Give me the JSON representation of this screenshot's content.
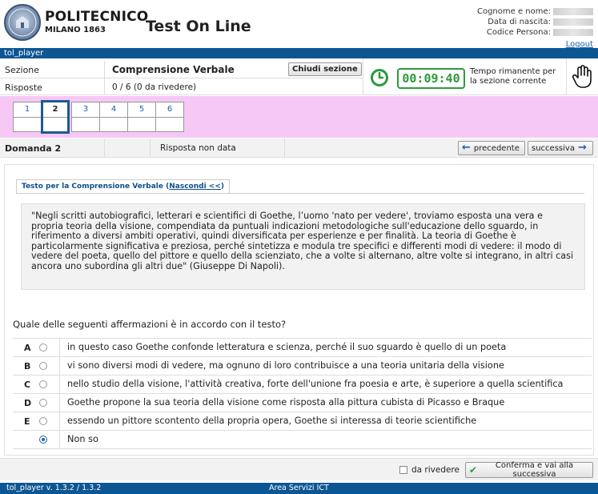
{
  "header": {
    "brand_line1": "POLITECNICO",
    "brand_line2": "MILANO 1863",
    "app_title": "Test On Line",
    "user_labels": [
      "Cognome e nome:",
      "Data di nascita:",
      "Codice Persona:"
    ],
    "logout": "Logout"
  },
  "topbar": {
    "label": "tol_player"
  },
  "info": {
    "sezione_label": "Sezione",
    "sezione_value": "Comprensione Verbale",
    "risposte_label": "Risposte",
    "risposte_value": "0 / 6 (0 da rivedere)",
    "close_section": "Chiudi sezione",
    "timer": "00:09:40",
    "timer_caption": "Tempo rimanente per la sezione corrente"
  },
  "nav": {
    "questions": [
      "1",
      "2",
      "3",
      "4",
      "5",
      "6"
    ],
    "current": "2"
  },
  "domanda": {
    "label": "Domanda 2",
    "status": "Risposta non data",
    "prev": "precedente",
    "next": "successiva"
  },
  "passage": {
    "tab_label": "Testo per la Comprensione Verbale",
    "tab_link": "Nascondi <<",
    "text": "\"Negli scritti autobiografici, letterari e scientifici di Goethe, l’uomo 'nato per vedere', troviamo esposta una vera e propria teoria della visione, compendiata da puntuali indicazioni metodologiche sull'educazione dello sguardo, in riferimento a diversi ambiti operativi, quindi diversificata per esperienze e per finalità. La teoria di Goethe è particolarmente significativa e preziosa, perché sintetizza e modula tre specifici e differenti modi di vedere: il modo di vedere del poeta, quello del pittore e quello della scienziato, che a volte si alternano, altre volte si integrano, in altri casi ancora uno subordina gli altri due\" (Giuseppe Di Napoli)."
  },
  "question": "Quale delle seguenti affermazioni è in accordo con il testo?",
  "answers": [
    {
      "letter": "A",
      "text": "in questo caso Goethe confonde letteratura e scienza, perché il suo sguardo è quello di un poeta"
    },
    {
      "letter": "B",
      "text": "vi sono diversi modi di vedere, ma ognuno di loro contribuisce a una teoria unitaria della visione"
    },
    {
      "letter": "C",
      "text": "nello studio della visione, l'attività creativa, forte dell'unione fra poesia e arte, è superiore a quella scientifica"
    },
    {
      "letter": "D",
      "text": "Goethe propone la sua teoria della visione come risposta alla pittura cubista di Picasso e Braque"
    },
    {
      "letter": "E",
      "text": "essendo un pittore scontento della propria opera, Goethe si interessa di teorie scientifiche"
    },
    {
      "letter": "",
      "text": "Non so"
    }
  ],
  "selected_answer": "Non so",
  "bottom": {
    "review_label": "da rivedere",
    "confirm": "Conferma e vai alla successiva"
  },
  "footer": {
    "version": "tol_player v. 1.3.2 / 1.3.2",
    "area": "Area Servizi ICT"
  },
  "colors": {
    "blue_bar": "#0d5694",
    "pink_nav": "#f6c8f6",
    "timer_green": "#2c9a3c"
  }
}
